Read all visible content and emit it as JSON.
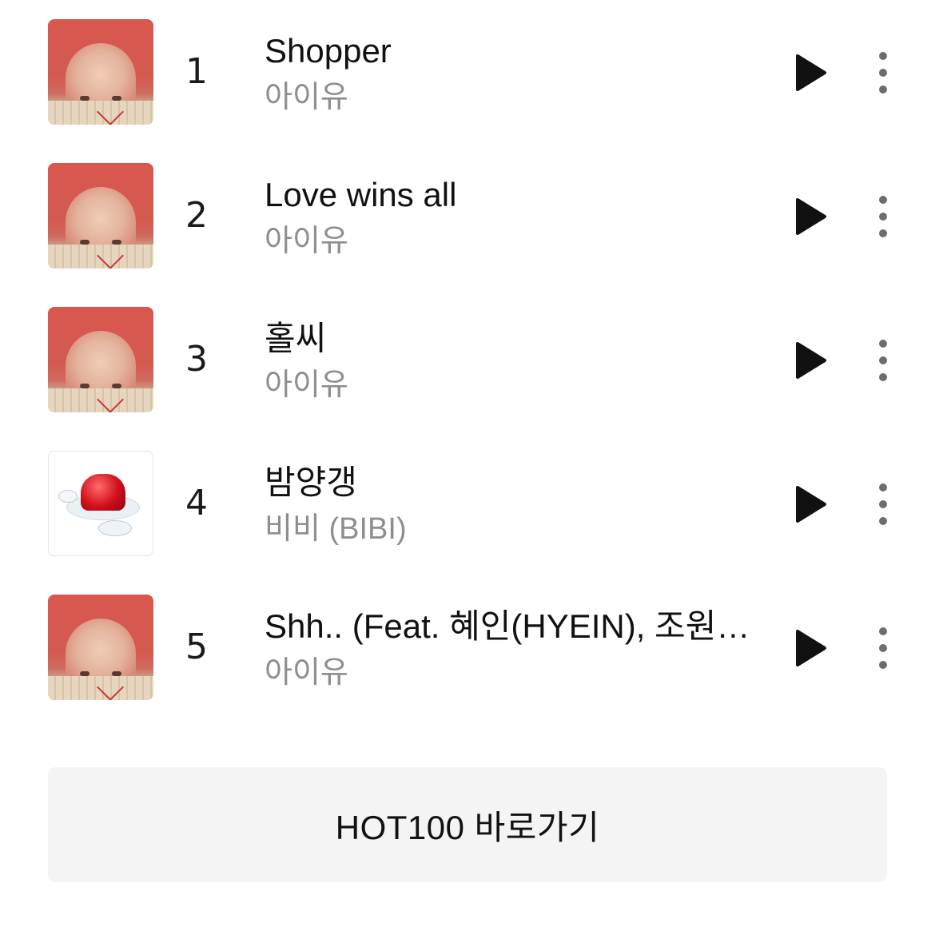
{
  "tracks": [
    {
      "rank": "1",
      "title": "Shopper",
      "artist": "아이유",
      "cover": "the-winning-album-cover"
    },
    {
      "rank": "2",
      "title": "Love wins all",
      "artist": "아이유",
      "cover": "the-winning-album-cover"
    },
    {
      "rank": "3",
      "title": "홀씨",
      "artist": "아이유",
      "cover": "the-winning-album-cover"
    },
    {
      "rank": "4",
      "title": "밤양갱",
      "artist": "비비 (BIBI)",
      "cover": "jelly-album-cover"
    },
    {
      "rank": "5",
      "title": "Shh.. (Feat. 혜인(HYEIN), 조원…",
      "artist": "아이유",
      "cover": "the-winning-album-cover"
    }
  ],
  "icons": {
    "play": "play-icon",
    "more": "more-vertical-icon"
  },
  "hot_button": {
    "label": "HOT100 바로가기"
  }
}
